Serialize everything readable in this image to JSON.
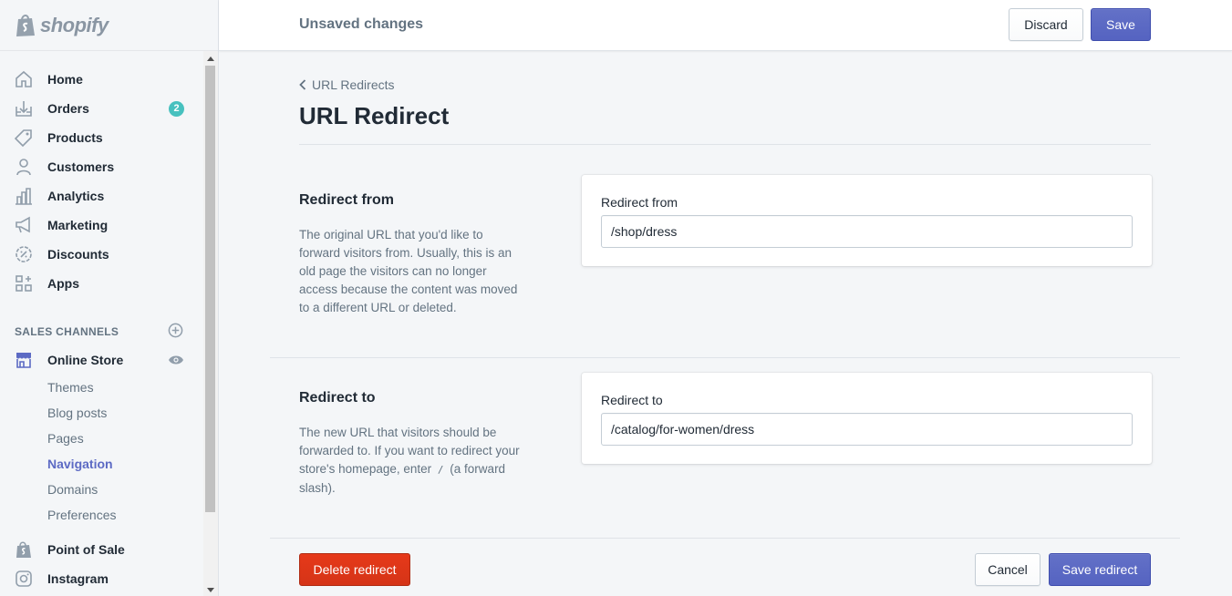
{
  "brand": {
    "name": "shopify"
  },
  "nav": {
    "items": [
      {
        "label": "Home",
        "icon": "home-icon"
      },
      {
        "label": "Orders",
        "icon": "orders-icon",
        "badge": "2"
      },
      {
        "label": "Products",
        "icon": "tag-icon"
      },
      {
        "label": "Customers",
        "icon": "person-icon"
      },
      {
        "label": "Analytics",
        "icon": "bar-chart-icon"
      },
      {
        "label": "Marketing",
        "icon": "megaphone-icon"
      },
      {
        "label": "Discounts",
        "icon": "discount-icon"
      },
      {
        "label": "Apps",
        "icon": "apps-icon"
      }
    ],
    "sales_channels_heading": "SALES CHANNELS",
    "online_store": {
      "label": "Online Store",
      "icon": "store-icon"
    },
    "sub_items": [
      "Themes",
      "Blog posts",
      "Pages",
      "Navigation",
      "Domains",
      "Preferences"
    ],
    "active_sub_item": "Navigation",
    "point_of_sale": {
      "label": "Point of Sale",
      "icon": "shopify-bag-icon"
    },
    "instagram": {
      "label": "Instagram",
      "icon": "instagram-icon"
    }
  },
  "topbar": {
    "status": "Unsaved changes",
    "discard_label": "Discard",
    "save_label": "Save"
  },
  "page": {
    "breadcrumb": "URL Redirects",
    "title": "URL Redirect"
  },
  "redirect_from": {
    "section_title": "Redirect from",
    "description": "The original URL that you'd like to forward visitors from. Usually, this is an old page the visitors can no longer access because the content was moved to a different URL or deleted.",
    "field_label": "Redirect from",
    "value": "/shop/dress"
  },
  "redirect_to": {
    "section_title": "Redirect to",
    "description_before": "The new URL that visitors should be forwarded to. If you want to redirect your store's homepage, enter ",
    "description_code": "/",
    "description_after": " (a forward slash).",
    "field_label": "Redirect to",
    "value": "/catalog/for-women/dress"
  },
  "footer": {
    "delete_label": "Delete redirect",
    "cancel_label": "Cancel",
    "save_label": "Save redirect"
  },
  "colors": {
    "primary": "#5c6ac4",
    "danger": "#de3618",
    "badge": "#47c1bf"
  }
}
